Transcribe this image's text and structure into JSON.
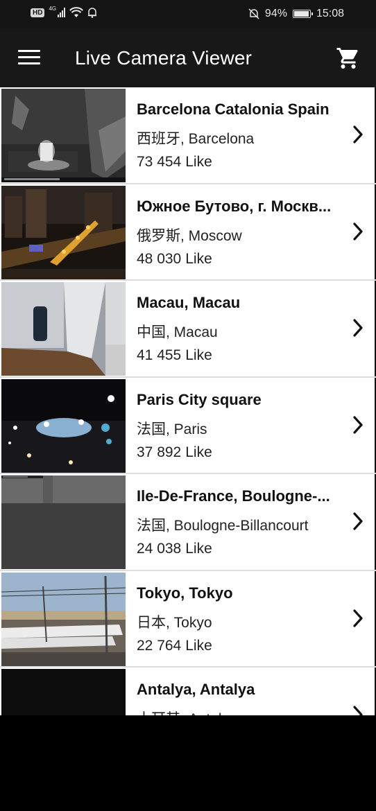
{
  "status_bar": {
    "hd": "HD",
    "network": "4G",
    "battery": "94%",
    "battery_level": 0.94,
    "time": "15:08"
  },
  "app_bar": {
    "title": "Live Camera Viewer",
    "menu_icon": "hamburger-menu-icon",
    "cart_icon": "shopping-cart-icon"
  },
  "cameras": [
    {
      "title": "Barcelona Catalonia Spain",
      "location": "西班牙, Barcelona",
      "likes": "73 454",
      "likes_label": "Like"
    },
    {
      "title": "Южное Бутово, г. Москв...",
      "location": "俄罗斯, Moscow",
      "likes": "48 030",
      "likes_label": "Like"
    },
    {
      "title": "Macau, Macau",
      "location": "中国, Macau",
      "likes": "41 455",
      "likes_label": "Like"
    },
    {
      "title": "Paris City square",
      "location": "法国, Paris",
      "likes": "37 892",
      "likes_label": "Like"
    },
    {
      "title": "Ile-De-France, Boulogne-...",
      "location": "法国, Boulogne-Billancourt",
      "likes": "24 038",
      "likes_label": "Like"
    },
    {
      "title": "Tokyo, Tokyo",
      "location": "日本, Tokyo",
      "likes": "22 764",
      "likes_label": "Like"
    },
    {
      "title": "Antalya, Antalya",
      "location": "土耳其, Antalya",
      "likes": "",
      "likes_label": ""
    }
  ],
  "colors": {
    "status_bar_bg": "#141414",
    "app_bar_bg": "#181818",
    "row_bg": "#ffffff",
    "text": "#111111"
  }
}
